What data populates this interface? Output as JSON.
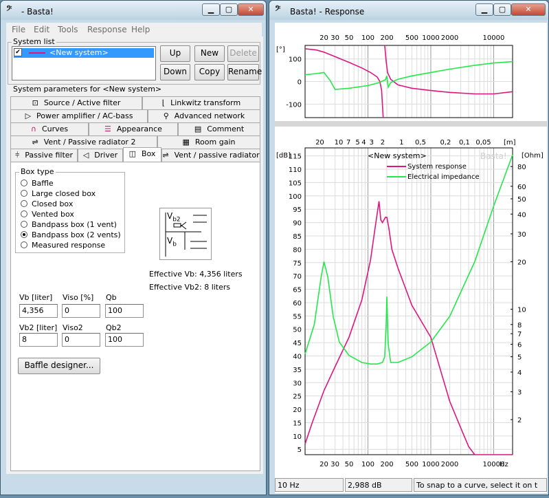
{
  "left_window": {
    "title": "- Basta!",
    "menu": [
      "File",
      "Edit",
      "Tools",
      "Response",
      "Help"
    ],
    "system_list": {
      "label": "System list",
      "item": "<New system>",
      "buttons": {
        "up": "Up",
        "new": "New",
        "delete": "Delete",
        "down": "Down",
        "copy": "Copy",
        "rename": "Rename"
      }
    },
    "params_label": "System parameters for <New system>",
    "tabs": {
      "source": "Source / Active filter",
      "linkwitz": "Linkwitz transform",
      "power_amp": "Power amplifier / AC-bass",
      "advanced": "Advanced network",
      "curves": "Curves",
      "appearance": "Appearance",
      "comment": "Comment",
      "vent2": "Vent / Passive radiator 2",
      "room": "Room gain",
      "passive": "Passive filter",
      "driver": "Driver",
      "box": "Box",
      "vent": "Vent / passive radiator"
    },
    "box_type": {
      "label": "Box type",
      "options": [
        "Baffle",
        "Large closed box",
        "Closed box",
        "Vented box",
        "Bandpass box (1 vent)",
        "Bandpass box (2 vents)",
        "Measured response"
      ],
      "selected": "Bandpass box (2 vents)"
    },
    "diagram": {
      "vb2": "V",
      "vb2_sub": "b2",
      "vb": "V",
      "vb_sub": "b"
    },
    "effective_vb": "Effective Vb: 4,356 liters",
    "effective_vb2": "Effective Vb2: 8 liters",
    "fields": {
      "vb_label": "Vb [liter]",
      "vb_value": "4,356",
      "viso_label": "Viso [%]",
      "viso_value": "0",
      "qb_label": "Qb",
      "qb_value": "100",
      "vb2_label": "Vb2 [liter]",
      "vb2_value": "8",
      "viso2_label": "Viso2",
      "viso2_value": "0",
      "qb2_label": "Qb2",
      "qb2_value": "100"
    },
    "baffle_button": "Baffle designer..."
  },
  "right_window": {
    "title": "Basta! - Response",
    "phase_chart": {
      "top_ticks": [
        "20",
        "30",
        "50",
        "100",
        "200",
        "500",
        "1000",
        "2000",
        "10000"
      ],
      "unit": "[°]",
      "yticks": [
        "100",
        "0",
        "-100"
      ]
    },
    "main_chart": {
      "top_ticks": [
        "20",
        "10",
        "7",
        "5",
        "4",
        "3",
        "2",
        "1",
        "0,5",
        "0,2",
        "0,1",
        "0,05"
      ],
      "top_unit": "[m]",
      "db_unit": "[dB]",
      "ohm_unit": "[Ohm]",
      "db_ticks": [
        "115",
        "110",
        "105",
        "100",
        "95",
        "90",
        "85",
        "80",
        "75",
        "70",
        "65",
        "60",
        "55",
        "50",
        "45",
        "40",
        "35",
        "30",
        "25",
        "20",
        "15",
        "10",
        "5"
      ],
      "ohm_ticks": [
        "80",
        "60",
        "50",
        "40",
        "30",
        "20",
        "10",
        "8",
        "7",
        "6",
        "5",
        "4",
        "3",
        "2"
      ],
      "bottom_ticks": [
        "20",
        "30",
        "50",
        "100",
        "200",
        "500",
        "1000",
        "2000",
        "10000"
      ],
      "bottom_unit": "Hz",
      "system_label": "<New system>",
      "watermark": "Basta!",
      "legend": [
        "System response",
        "Electrical impedance"
      ]
    },
    "status": [
      "10 Hz",
      "2,988 dB",
      "To snap to a curve, select it on t"
    ]
  },
  "colors": {
    "response": "#e0147e",
    "impedance": "#22e84a",
    "selection": "#3399ff"
  },
  "chart_data": [
    {
      "type": "line",
      "title": "",
      "xlabel": "",
      "ylabel": "[°]",
      "xscale": "log",
      "xlim": [
        10,
        20000
      ],
      "ylim": [
        -160,
        160
      ],
      "series": [
        {
          "name": "",
          "color": "#e0147e",
          "x": [
            10,
            15,
            20,
            30,
            50,
            80,
            110,
            140,
            155,
            165,
            175
          ],
          "y": [
            145,
            140,
            130,
            110,
            85,
            60,
            40,
            20,
            0,
            -40,
            -160
          ]
        },
        {
          "name": "",
          "color": "#e0147e",
          "x": [
            185,
            195,
            205,
            230,
            300,
            500,
            1000,
            2000,
            5000,
            10000,
            20000
          ],
          "y": [
            160,
            90,
            40,
            10,
            -15,
            -30,
            -40,
            -48,
            -55,
            -55,
            -45
          ]
        },
        {
          "name": "",
          "color": "#22e84a",
          "x": [
            10,
            15,
            20,
            25,
            30,
            50,
            100,
            150,
            190,
            200,
            210,
            230,
            300,
            500,
            1000,
            2000,
            5000,
            10000,
            20000
          ],
          "y": [
            30,
            35,
            40,
            5,
            -35,
            -30,
            -18,
            -5,
            8,
            25,
            -25,
            -5,
            10,
            25,
            40,
            55,
            72,
            82,
            88
          ]
        }
      ]
    },
    {
      "type": "line",
      "title": "",
      "xlabel": "",
      "ylabel": "[dB]",
      "y2label": "[Ohm]",
      "xscale": "log",
      "xlim": [
        10,
        20000
      ],
      "ylim": [
        3,
        118
      ],
      "series": [
        {
          "name": "System response",
          "color": "#e0147e",
          "x": [
            10,
            13,
            20,
            30,
            50,
            80,
            110,
            130,
            150,
            160,
            170,
            190,
            200,
            215,
            240,
            300,
            500,
            1000,
            2000,
            3000,
            4000,
            5000,
            20000
          ],
          "y": [
            7,
            15,
            27,
            36,
            47,
            61,
            76,
            88,
            98,
            91,
            90,
            92,
            92,
            88,
            80,
            73,
            59,
            47,
            23,
            13,
            6,
            3,
            3
          ]
        },
        {
          "name": "Electrical impedance",
          "color": "#22e84a",
          "x": [
            10,
            14,
            18,
            20,
            23,
            28,
            35,
            50,
            80,
            110,
            140,
            170,
            185,
            195,
            200,
            210,
            230,
            300,
            500,
            1000,
            2000,
            5000,
            10000,
            20000
          ],
          "y": [
            5.2,
            8,
            16,
            20,
            16,
            9,
            6.2,
            5.1,
            4.6,
            4.5,
            4.5,
            4.6,
            5,
            8,
            12,
            6,
            4.6,
            4.6,
            5,
            6.2,
            9,
            20,
            45,
            95
          ]
        }
      ]
    }
  ]
}
